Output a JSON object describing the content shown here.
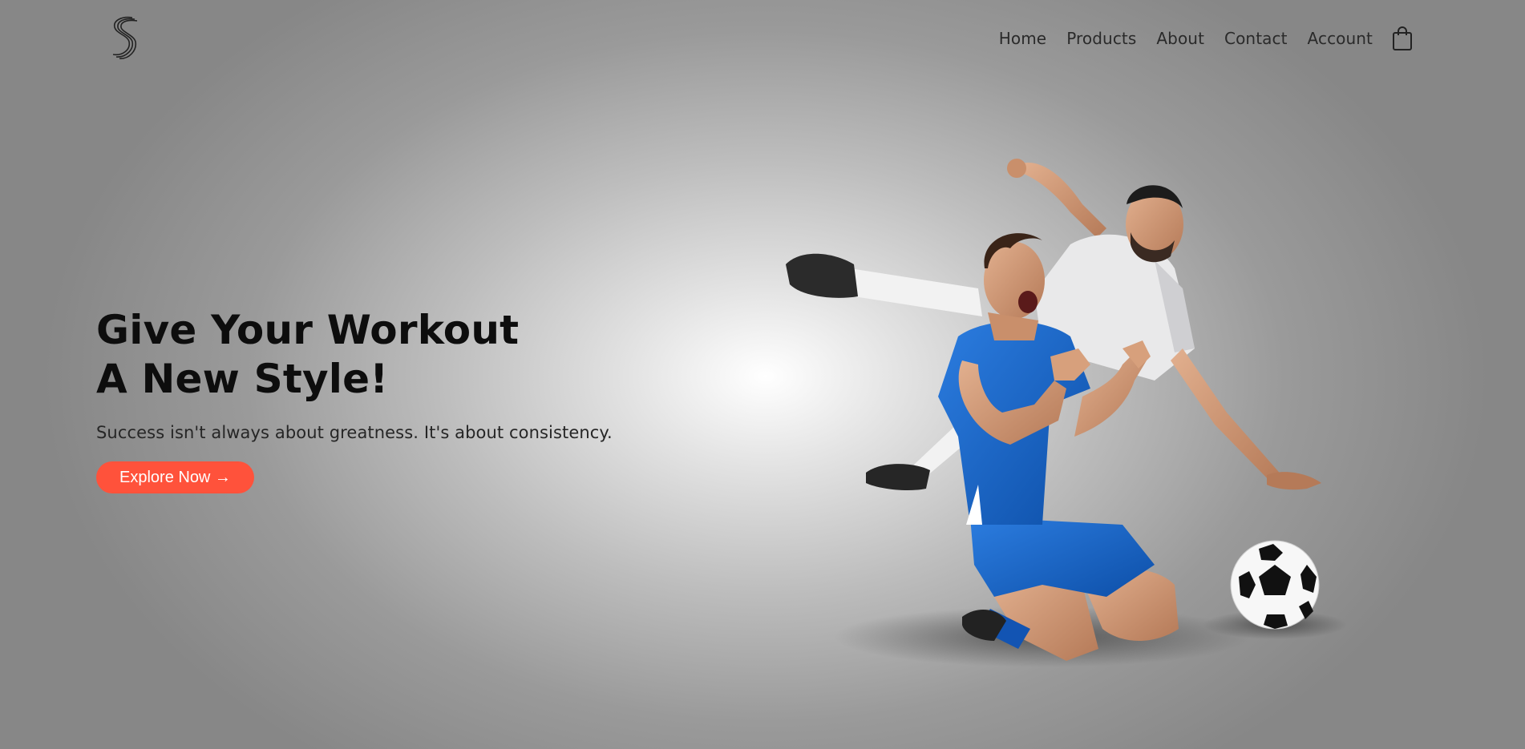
{
  "header": {
    "logo_icon": "stylized-s-logo-icon",
    "nav": [
      {
        "label": "Home"
      },
      {
        "label": "Products"
      },
      {
        "label": "About"
      },
      {
        "label": "Contact"
      },
      {
        "label": "Account"
      }
    ],
    "cart_icon": "shopping-bag-icon"
  },
  "hero": {
    "title_line1": "Give Your Workout",
    "title_line2": "A New Style!",
    "subtitle": "Success isn't always about greatness. It's about consistency.",
    "cta_label": "Explore Now →"
  },
  "colors": {
    "accent": "#ff523b",
    "text_dark": "#0d0d0d",
    "background_center": "#ffffff",
    "background_edge": "#878787"
  }
}
